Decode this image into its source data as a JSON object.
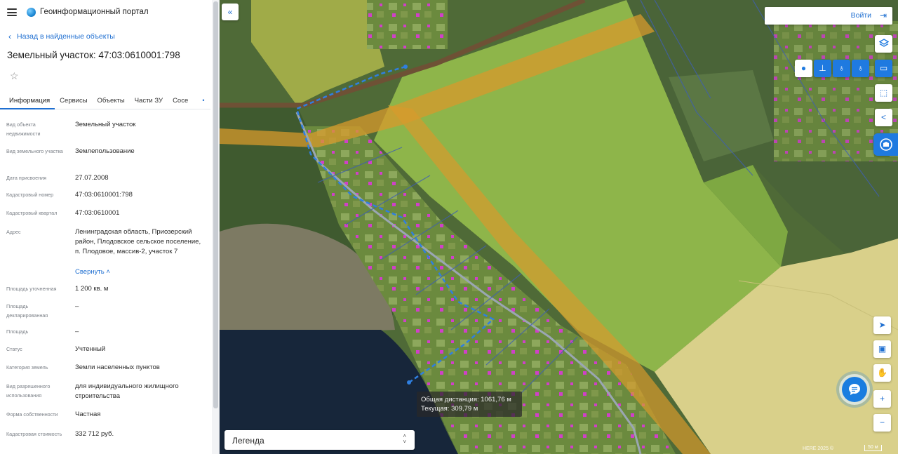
{
  "header": {
    "app_title": "Геоинформационный портал"
  },
  "panel": {
    "back_label": "Назад в найденные объекты",
    "object_title": "Земельный участок: 47:03:0610001:798",
    "tabs": [
      {
        "label": "Информация",
        "active": true
      },
      {
        "label": "Сервисы",
        "active": false
      },
      {
        "label": "Объекты",
        "active": false
      },
      {
        "label": "Части ЗУ",
        "active": false
      },
      {
        "label": "Сосе",
        "active": false
      }
    ],
    "fields": [
      {
        "label": "Вид объекта недвижимости",
        "value": "Земельный участок"
      },
      {
        "label": "Вид земельного участка",
        "value": "Землепользование"
      },
      {
        "label": "Дата присвоения",
        "value": "27.07.2008"
      },
      {
        "label": "Кадастровый номер",
        "value": "47:03:0610001:798"
      },
      {
        "label": "Кадастровый квартал",
        "value": "47:03:0610001"
      },
      {
        "label": "Адрес",
        "value": "Ленинградская область, Приозерский район, Плодовское сельское поселение, п. Плодовое, массив-2, участок 7"
      },
      {
        "label": "Площадь уточненная",
        "value": "1 200 кв. м"
      },
      {
        "label": "Площадь декларированная",
        "value": "–"
      },
      {
        "label": "Площадь",
        "value": "–"
      },
      {
        "label": "Статус",
        "value": "Учтенный"
      },
      {
        "label": "Категория земель",
        "value": "Земли населенных пунктов"
      },
      {
        "label": "Вид разрешенного использования",
        "value": "для индивидуального жилищного строительства"
      },
      {
        "label": "Форма собственности",
        "value": "Частная"
      },
      {
        "label": "Кадастровая стоимость",
        "value": "332 712 руб."
      }
    ],
    "collapse_label": "Свернуть"
  },
  "map": {
    "login_label": "Войти",
    "measure": {
      "total": "Общая дистанция: 1061,76 м",
      "current": "Текущая: 309,79 м"
    },
    "legend_label": "Легенда",
    "attribution": "HERE 2025 ©",
    "scale_label": "50 м",
    "colors": {
      "accent": "#1f7ae0",
      "zone_green": "#9ac24b",
      "zone_yellow": "#e6d882",
      "band_orange": "#d79a2c",
      "measure_line": "#2f7fe0"
    }
  },
  "icons": [
    "menu-icon",
    "globe-logo-icon",
    "chevron-left-icon",
    "star-icon",
    "login-icon",
    "layers-icon",
    "point-icon",
    "line-icon",
    "marker-icon",
    "marker-outline-icon",
    "ruler-icon",
    "select-area-icon",
    "share-icon",
    "cadastre-icon",
    "locate-icon",
    "print-icon",
    "hand-icon",
    "zoom-in-icon",
    "zoom-out-icon",
    "chat-icon",
    "collapse-panel-icon"
  ]
}
